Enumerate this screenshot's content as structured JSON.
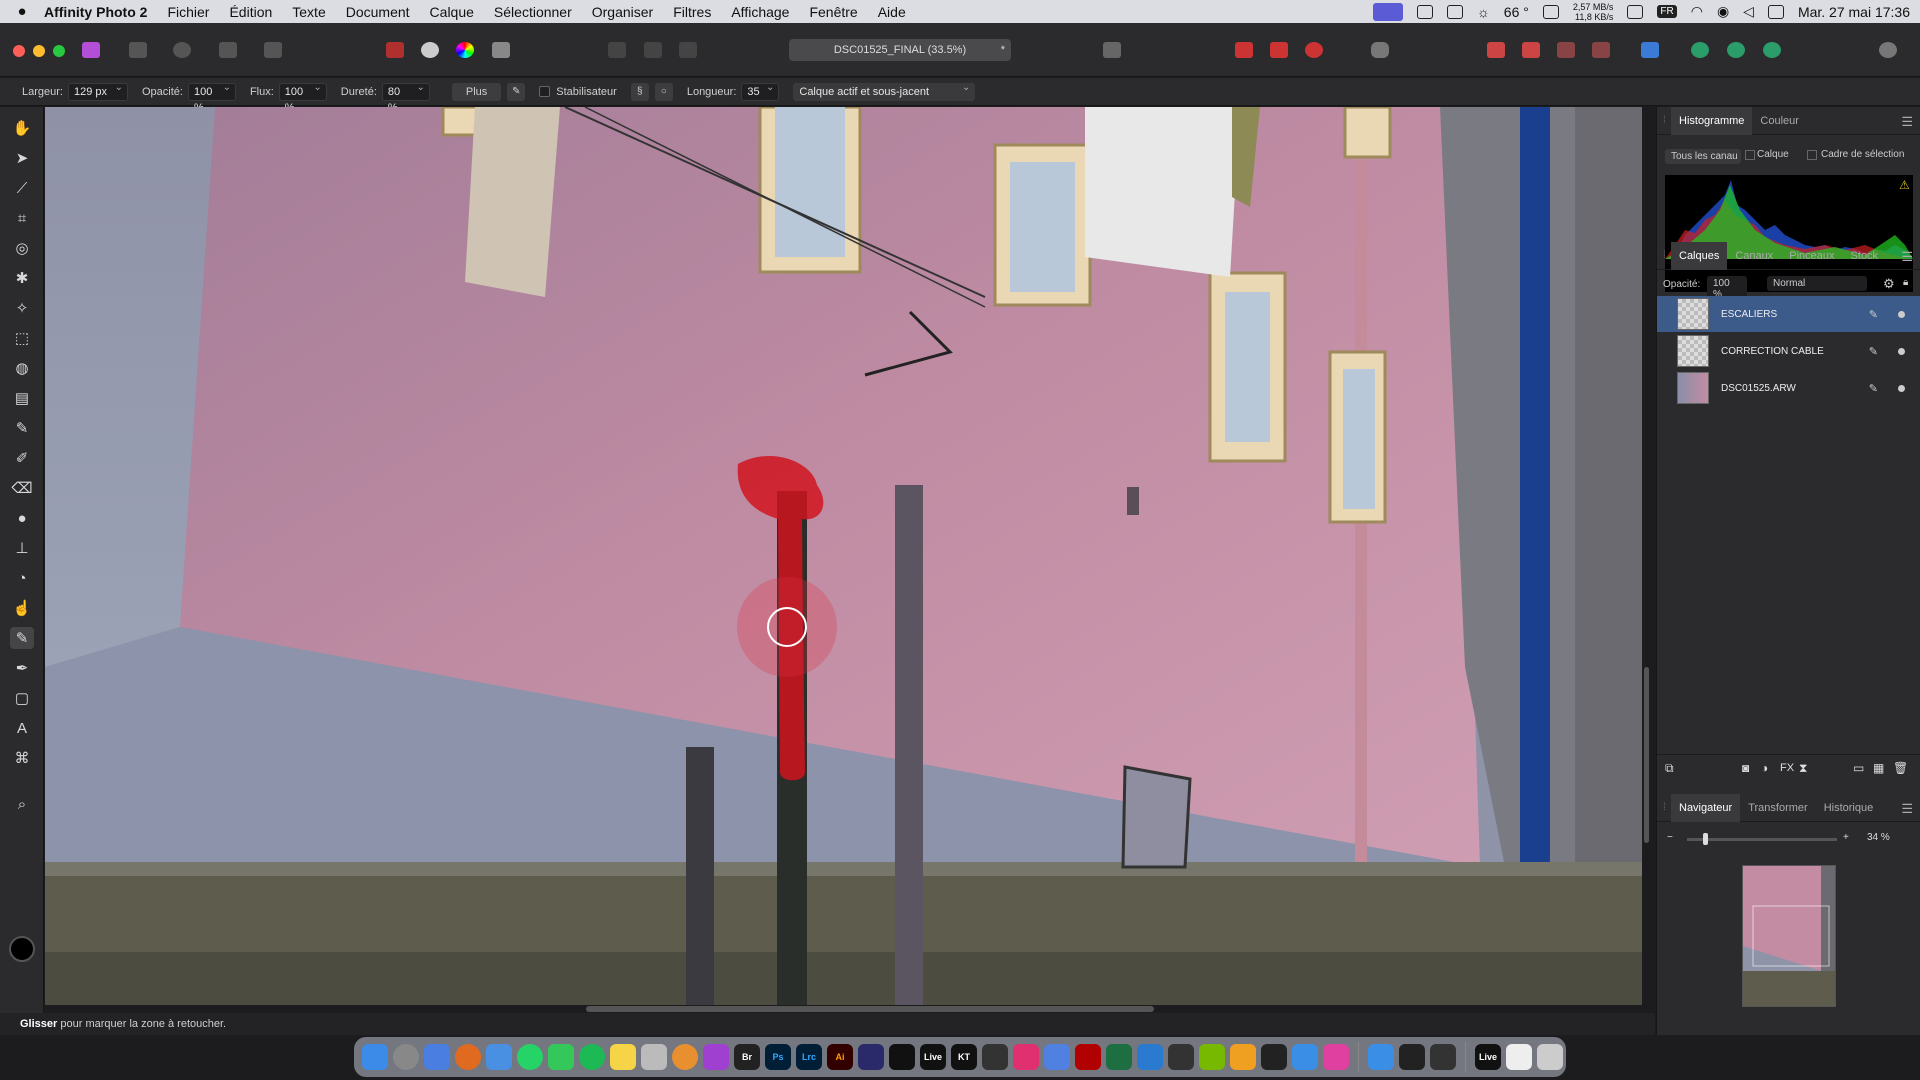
{
  "menubar": {
    "app_name": "Affinity Photo 2",
    "items": [
      "Fichier",
      "Édition",
      "Texte",
      "Document",
      "Calque",
      "Sélectionner",
      "Organiser",
      "Filtres",
      "Affichage",
      "Fenêtre",
      "Aide"
    ],
    "temperature": "66 °",
    "net_up": "2,57 MB/s",
    "net_down": "11,8 KB/s",
    "input_lang": "FR",
    "datetime": "Mar. 27 mai  17:36"
  },
  "toolbar": {
    "document_title": "DSC01525_FINAL (33.5%)",
    "modified_mark": "*"
  },
  "context": {
    "width_label": "Largeur:",
    "width_value": "129 px",
    "opacity_label": "Opacité:",
    "opacity_value": "100 %",
    "flow_label": "Flux:",
    "flow_value": "100 %",
    "hardness_label": "Dureté:",
    "hardness_value": "80 %",
    "more_button": "Plus",
    "stabilizer_label": "Stabilisateur",
    "length_label": "Longueur:",
    "length_value": "35",
    "sampling_value": "Calque actif et sous-jacent"
  },
  "histogram": {
    "tabs": [
      "Histogramme",
      "Couleur"
    ],
    "channel": "Tous les canau",
    "layer_option": "Calque",
    "selection_option": "Cadre de sélection"
  },
  "layers": {
    "tabs": [
      "Calques",
      "Canaux",
      "Pinceaux",
      "Stock"
    ],
    "opacity_label": "Opacité:",
    "opacity_value": "100 %",
    "blend_mode": "Normal",
    "items": [
      {
        "name": "ESCALIERS",
        "selected": true
      },
      {
        "name": "CORRECTION CABLE",
        "selected": false
      },
      {
        "name": "DSC01525.ARW",
        "selected": false
      }
    ]
  },
  "navigator": {
    "tabs": [
      "Navigateur",
      "Transformer",
      "Historique"
    ],
    "zoom": "34 %"
  },
  "status": {
    "action": "Glisser",
    "hint": "pour marquer la zone à retoucher."
  },
  "dock": {
    "br_label": "Br",
    "ps_label": "Ps",
    "lrc_label": "Lrc",
    "ai_label": "Ai",
    "live_label": "Live",
    "kt_label": "KT",
    "live2_label": "Live"
  },
  "colors": {
    "accent": "#3c5a8a",
    "wall": "#b37d96",
    "retouch_mask": "#d0141e"
  }
}
